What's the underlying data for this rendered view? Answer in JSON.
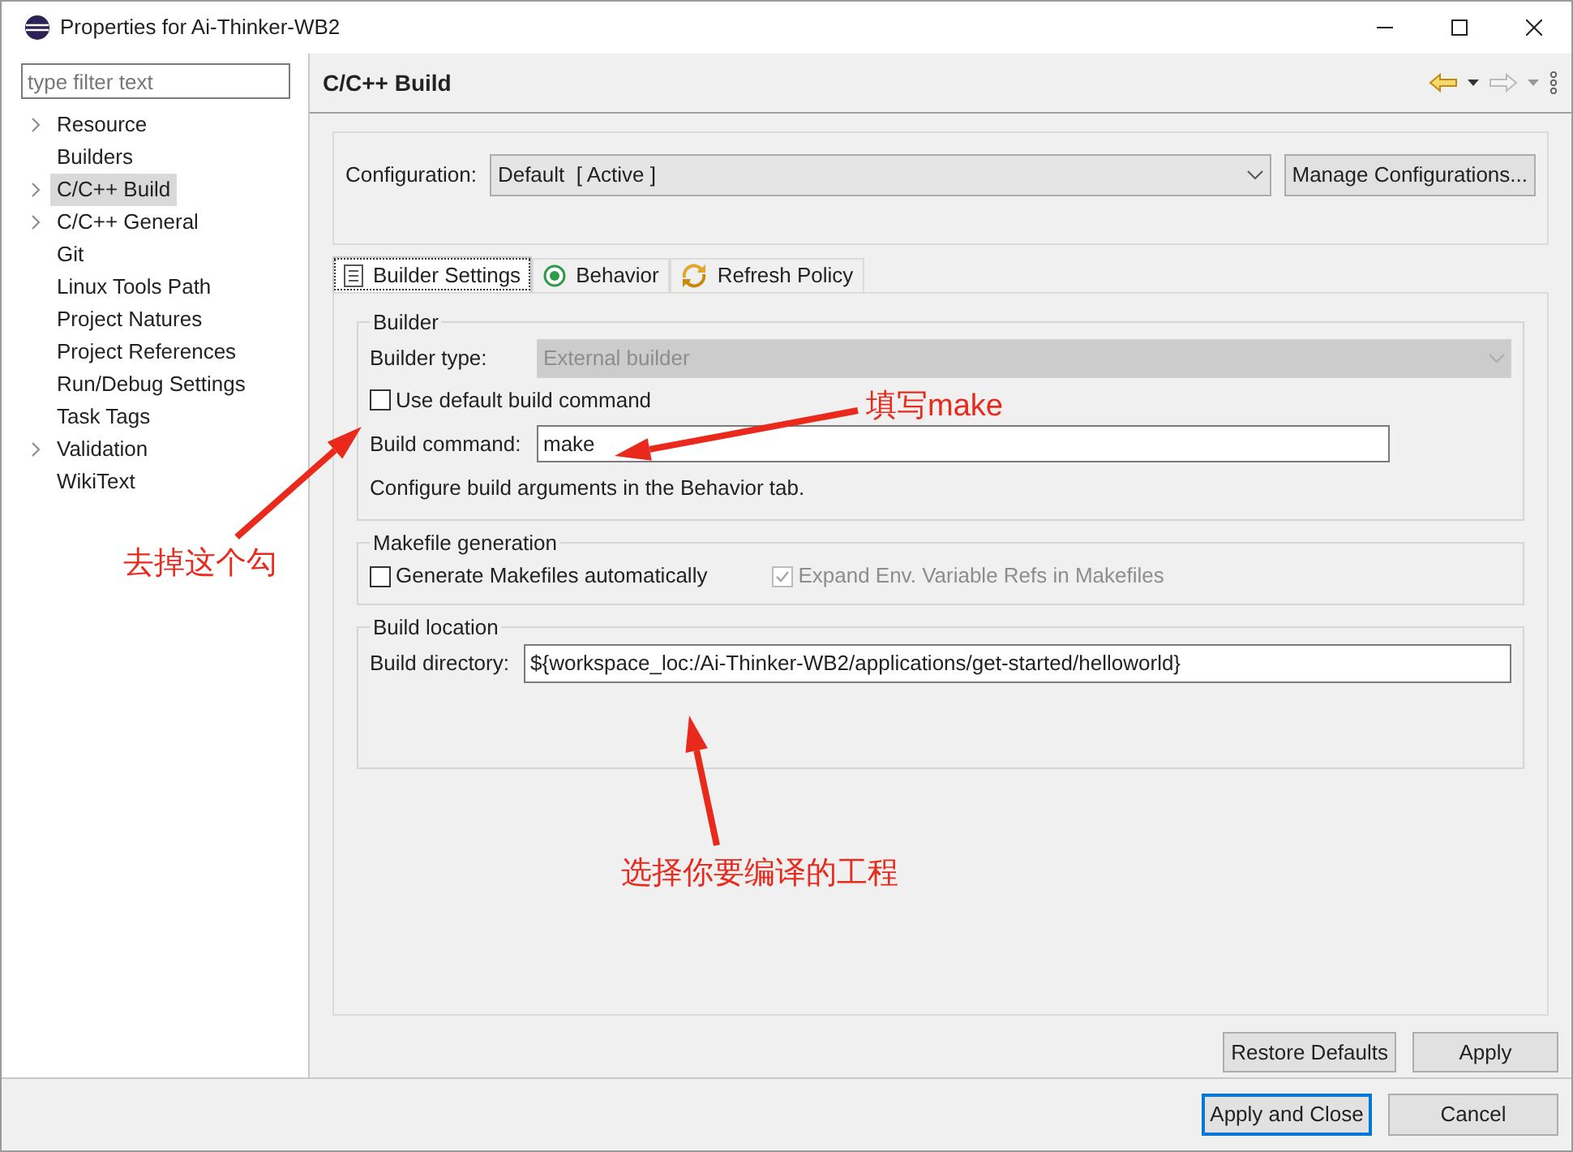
{
  "window": {
    "title": "Properties for Ai-Thinker-WB2"
  },
  "sidebar": {
    "filter": {
      "placeholder": "type filter text"
    },
    "items": [
      {
        "label": "Resource",
        "expandable": true,
        "selected": false
      },
      {
        "label": "Builders",
        "expandable": false,
        "selected": false
      },
      {
        "label": "C/C++ Build",
        "expandable": true,
        "selected": true
      },
      {
        "label": "C/C++ General",
        "expandable": true,
        "selected": false
      },
      {
        "label": "Git",
        "expandable": false,
        "selected": false
      },
      {
        "label": "Linux Tools Path",
        "expandable": false,
        "selected": false
      },
      {
        "label": "Project Natures",
        "expandable": false,
        "selected": false
      },
      {
        "label": "Project References",
        "expandable": false,
        "selected": false
      },
      {
        "label": "Run/Debug Settings",
        "expandable": false,
        "selected": false
      },
      {
        "label": "Task Tags",
        "expandable": false,
        "selected": false
      },
      {
        "label": "Validation",
        "expandable": true,
        "selected": false
      },
      {
        "label": "WikiText",
        "expandable": false,
        "selected": false
      }
    ]
  },
  "page": {
    "title": "C/C++ Build",
    "configuration": {
      "label": "Configuration:",
      "value": "Default  [ Active ]",
      "button": "Manage Configurations..."
    },
    "tabs": [
      {
        "label": "Builder Settings",
        "kind": "list",
        "selected": true
      },
      {
        "label": "Behavior",
        "kind": "target",
        "selected": false
      },
      {
        "label": "Refresh Policy",
        "kind": "refresh",
        "selected": false
      }
    ],
    "builder": {
      "legend": "Builder",
      "type_label": "Builder type:",
      "type_value": "External builder",
      "type_disabled": true,
      "use_default": {
        "label": "Use default build command",
        "checked": false
      },
      "command_label": "Build command:",
      "command_value": "make",
      "note": "Configure build arguments in the Behavior tab."
    },
    "makefile": {
      "legend": "Makefile generation",
      "options": [
        {
          "label": "Generate Makefiles automatically",
          "checked": false,
          "disabled": false
        },
        {
          "label": "Expand Env. Variable Refs in Makefiles",
          "checked": true,
          "disabled": true
        }
      ]
    },
    "location": {
      "legend": "Build location",
      "directory_label": "Build directory:",
      "directory_value": "${workspace_loc:/Ai-Thinker-WB2/applications/get-started/helloworld}"
    },
    "buttons": [
      "Restore Defaults",
      "Apply"
    ]
  },
  "footer": {
    "buttons": [
      {
        "label": "Apply and Close",
        "selected": true
      },
      {
        "label": "Cancel",
        "selected": false
      }
    ]
  },
  "annotations": [
    "去掉这个勾",
    "填写make",
    "选择你要编译的工程"
  ]
}
